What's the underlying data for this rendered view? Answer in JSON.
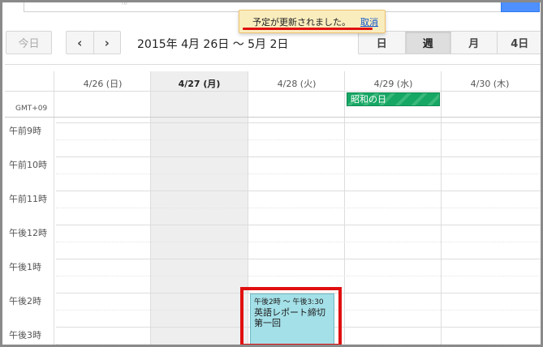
{
  "search": {
    "ghost_text": "ㅤ ㅤ  ᵗᵇ"
  },
  "toolbar": {
    "today_label": "今日",
    "prev_icon": "‹",
    "next_icon": "›",
    "date_range": "2015年 4月 26日 ～ 5月 2日",
    "views": [
      "日",
      "週",
      "月",
      "4日"
    ],
    "active_view": "週"
  },
  "notification": {
    "message": "予定が更新されました。",
    "undo_label": "取消"
  },
  "calendar": {
    "days": [
      "4/26 (日)",
      "4/27 (月)",
      "4/28 (火)",
      "4/29 (水)",
      "4/30 (木)"
    ],
    "timezone": "GMT+09",
    "holiday": {
      "day": "4/29 (水)",
      "label": "昭和の日"
    },
    "hours": [
      "午前9時",
      "午前10時",
      "午前11時",
      "午後12時",
      "午後1時",
      "午後2時",
      "午後3時"
    ]
  },
  "event": {
    "time": "午後2時 ～ 午後3:30",
    "title": "英語レポート締切 第一回"
  },
  "colors": {
    "holiday": "#16a765",
    "event": "#a4e0e8",
    "highlight": "#e01010",
    "notification_bg": "#f9edbe"
  }
}
